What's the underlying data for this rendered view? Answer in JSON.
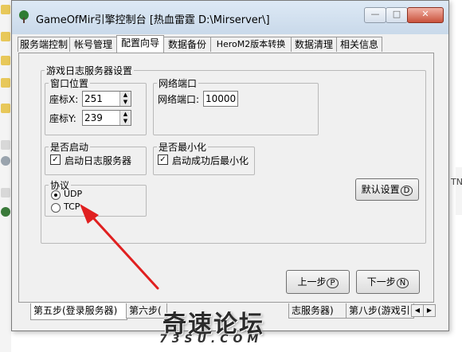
{
  "window": {
    "title": "GameOfMir引擎控制台 [热血雷霆 D:\\Mirserver\\]",
    "controls": {
      "minimize": "—",
      "maximize": "□",
      "close": "✕"
    }
  },
  "tabs": [
    "服务端控制",
    "帐号管理",
    "配置向导",
    "数据备份",
    "HeroM2版本转换",
    "数据清理",
    "相关信息"
  ],
  "active_tab": "配置向导",
  "page": {
    "group_title": "游戏日志服务器设置",
    "window_pos": {
      "title": "窗口位置",
      "x_label": "座标X:",
      "x_value": "251",
      "y_label": "座标Y:",
      "y_value": "239"
    },
    "network": {
      "title": "网络端口",
      "port_label": "网络端口:",
      "port_value": "10000"
    },
    "autostart": {
      "title": "是否启动",
      "checkbox_label": "启动日志服务器",
      "checked": true
    },
    "minimize": {
      "title": "是否最小化",
      "checkbox_label": "启动成功后最小化",
      "checked": true
    },
    "protocol": {
      "title": "协议",
      "options": [
        "UDP",
        "TCP"
      ],
      "selected": "UDP"
    },
    "default_button": {
      "label": "默认设置",
      "key": "D"
    },
    "prev_button": {
      "label": "上一步",
      "key": "P"
    },
    "next_button": {
      "label": "下一步",
      "key": "N"
    }
  },
  "bottom_tabs": [
    "第五步(登录服务器)",
    "第六步(",
    "志服务器)",
    "第八步(游戏引"
  ],
  "bottom_scroll": {
    "left": "◀",
    "right": "▶"
  },
  "watermark": {
    "main": "奇速论坛",
    "sub": "73SU.COM"
  },
  "background_fragment": "TN",
  "colors": {
    "arrow": "#e02020",
    "window_bg": "#f0f0f0",
    "titlebar": "#c9d9ea",
    "close_button": "#c9523c"
  }
}
